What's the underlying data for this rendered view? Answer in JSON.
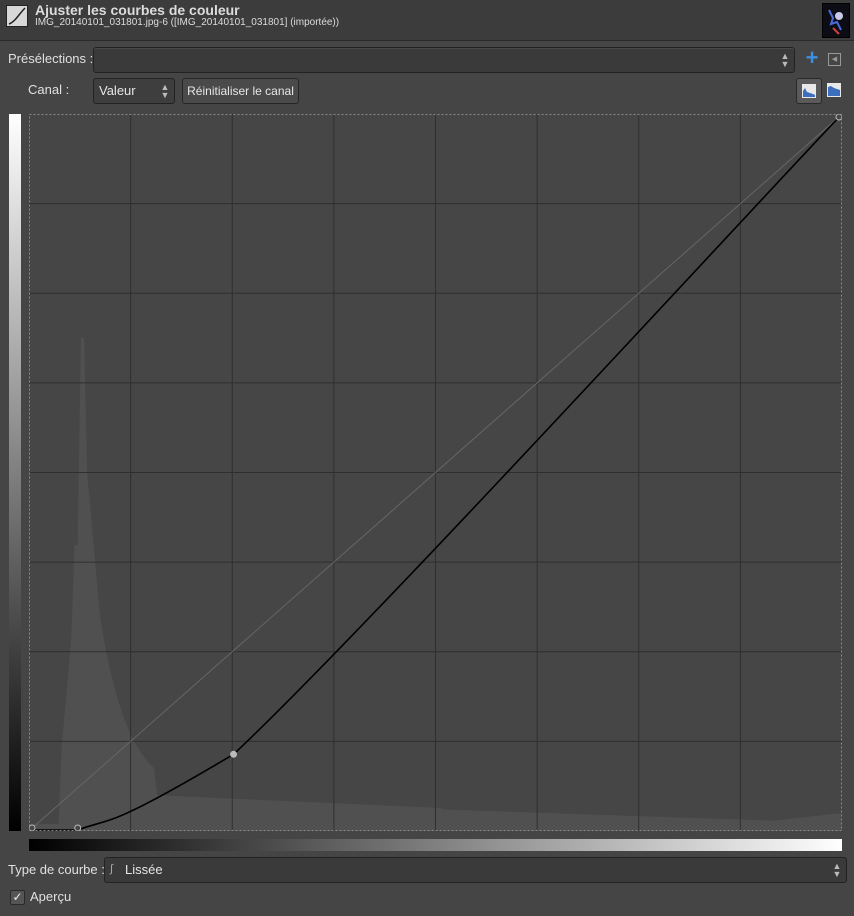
{
  "header": {
    "title": "Ajuster les courbes de couleur",
    "subtitle": "IMG_20140101_031801.jpg-6 ([IMG_20140101_031801] (importée))",
    "tool_icon": "curves-tool-icon",
    "thumbnail_icon": "image-thumbnail"
  },
  "presets": {
    "label": "Présélections :",
    "value": "",
    "add_icon": "plus-icon",
    "menu_icon": "menu-arrow-icon"
  },
  "channel": {
    "label": "Canal :",
    "value": "Valeur",
    "reset_label": "Réinitialiser le canal",
    "linear_hist_icon": "linear-histogram-icon",
    "log_hist_icon": "logarithmic-histogram-icon"
  },
  "curve": {
    "points": [
      [
        0,
        0
      ],
      [
        15,
        0
      ],
      [
        64,
        27
      ],
      [
        255,
        255
      ]
    ],
    "range": [
      0,
      255
    ],
    "selected_point": 2,
    "grid_divisions": 8
  },
  "curve_type": {
    "label": "Type de courbe :",
    "value": "Lissée",
    "icon": "smooth-curve-icon"
  },
  "preview": {
    "label": "Aperçu",
    "checked": true
  },
  "colors": {
    "background": "#454545",
    "curve": "#000000",
    "grid": "#2f2f2f",
    "histogram": "#505050",
    "accent": "#3d8fe0"
  }
}
